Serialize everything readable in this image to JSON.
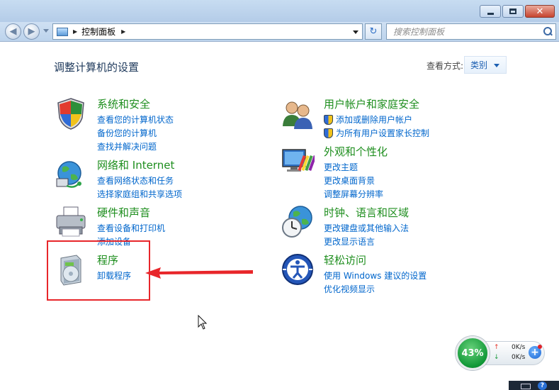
{
  "window": {
    "minimize_label": "—",
    "maximize_label": "▢",
    "close_label": "✕"
  },
  "nav": {
    "back_glyph": "◀",
    "forward_glyph": "▶",
    "breadcrumb": "控制面板",
    "refresh_glyph": "↻",
    "search_placeholder": "搜索控制面板"
  },
  "header": {
    "title": "调整计算机的设置",
    "view_by_label": "查看方式:",
    "view_by_value": "类别"
  },
  "categories_left": [
    {
      "title": "系统和安全",
      "icon": "security-shield-icon",
      "links": [
        "查看您的计算机状态",
        "备份您的计算机",
        "查找并解决问题"
      ]
    },
    {
      "title": "网络和 Internet",
      "icon": "network-globe-icon",
      "links": [
        "查看网络状态和任务",
        "选择家庭组和共享选项"
      ]
    },
    {
      "title": "硬件和声音",
      "icon": "printer-icon",
      "links": [
        "查看设备和打印机",
        "添加设备"
      ]
    },
    {
      "title": "程序",
      "icon": "programs-disc-icon",
      "links": [
        "卸载程序"
      ]
    }
  ],
  "categories_right": [
    {
      "title": "用户帐户和家庭安全",
      "icon": "users-icon",
      "links": [
        "添加或删除用户帐户",
        "为所有用户设置家长控制"
      ]
    },
    {
      "title": "外观和个性化",
      "icon": "monitor-palette-icon",
      "links": [
        "更改主题",
        "更改桌面背景",
        "调整屏幕分辨率"
      ]
    },
    {
      "title": "时钟、语言和区域",
      "icon": "clock-globe-icon",
      "links": [
        "更改键盘或其他输入法",
        "更改显示语言"
      ]
    },
    {
      "title": "轻松访问",
      "icon": "accessibility-icon",
      "links": [
        "使用 Windows 建议的设置",
        "优化视频显示"
      ]
    }
  ],
  "net_widget": {
    "percent": "43%",
    "upload": "0K/s",
    "download": "0K/s",
    "plus": "+"
  },
  "tray": {
    "help_glyph": "?"
  },
  "colors": {
    "category_title": "#1e8e1e",
    "link": "#0066cc",
    "annotation": "#e8262a"
  }
}
